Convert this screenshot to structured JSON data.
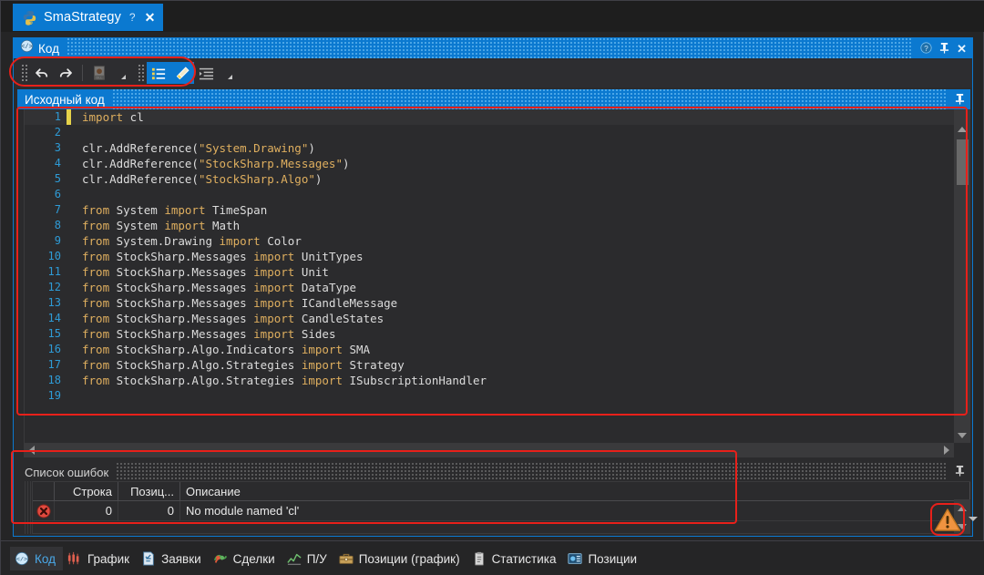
{
  "window": {
    "document_tab": {
      "title": "SmaStrategy",
      "icon": "python-icon",
      "help_label": "?",
      "close_label": "✕"
    }
  },
  "code_panel": {
    "caption": "Код",
    "icon": "code-icon",
    "help_label": "?",
    "pin_label": "⚐",
    "close_label": "✕",
    "toolbar": {
      "buttons": [
        {
          "name": "undo-button",
          "glyph": "↶",
          "state": "enabled"
        },
        {
          "name": "redo-button",
          "glyph": "↷",
          "state": "enabled"
        },
        {
          "name": "references-button",
          "glyph": "dll-file-icon",
          "state": "disabled"
        },
        {
          "name": "references-dropdown",
          "glyph": "caret",
          "state": "enabled"
        },
        {
          "name": "outline-toggle",
          "glyph": "list-icon",
          "state": "active"
        },
        {
          "name": "highlight-toggle",
          "glyph": "marker-pen-icon",
          "state": "active"
        },
        {
          "name": "indent-button",
          "glyph": "indent-icon",
          "state": "enabled"
        },
        {
          "name": "indent-dropdown",
          "glyph": "caret",
          "state": "enabled"
        }
      ]
    }
  },
  "source_panel": {
    "caption": "Исходный код",
    "pin_label": "⚐",
    "scroll": {
      "vertical": "near-top",
      "horizontal": "left"
    }
  },
  "editor": {
    "language": "python",
    "current_line": 1,
    "lines": [
      {
        "n": "1",
        "text": "import cl",
        "modified": true,
        "current": true
      },
      {
        "n": "2",
        "text": "",
        "modified": false,
        "current": false
      },
      {
        "n": "3",
        "text": "clr.AddReference(\"System.Drawing\")",
        "modified": false,
        "current": false
      },
      {
        "n": "4",
        "text": "clr.AddReference(\"StockSharp.Messages\")",
        "modified": false,
        "current": false
      },
      {
        "n": "5",
        "text": "clr.AddReference(\"StockSharp.Algo\")",
        "modified": false,
        "current": false
      },
      {
        "n": "6",
        "text": "",
        "modified": false,
        "current": false
      },
      {
        "n": "7",
        "text": "from System import TimeSpan",
        "modified": false,
        "current": false
      },
      {
        "n": "8",
        "text": "from System import Math",
        "modified": false,
        "current": false
      },
      {
        "n": "9",
        "text": "from System.Drawing import Color",
        "modified": false,
        "current": false
      },
      {
        "n": "10",
        "text": "from StockSharp.Messages import UnitTypes",
        "modified": false,
        "current": false
      },
      {
        "n": "11",
        "text": "from StockSharp.Messages import Unit",
        "modified": false,
        "current": false
      },
      {
        "n": "12",
        "text": "from StockSharp.Messages import DataType",
        "modified": false,
        "current": false
      },
      {
        "n": "13",
        "text": "from StockSharp.Messages import ICandleMessage",
        "modified": false,
        "current": false
      },
      {
        "n": "14",
        "text": "from StockSharp.Messages import CandleStates",
        "modified": false,
        "current": false
      },
      {
        "n": "15",
        "text": "from StockSharp.Messages import Sides",
        "modified": false,
        "current": false
      },
      {
        "n": "16",
        "text": "from StockSharp.Algo.Indicators import SMA",
        "modified": false,
        "current": false
      },
      {
        "n": "17",
        "text": "from StockSharp.Algo.Strategies import Strategy",
        "modified": false,
        "current": false
      },
      {
        "n": "18",
        "text": "from StockSharp.Algo.Strategies import ISubscriptionHandler",
        "modified": false,
        "current": false
      },
      {
        "n": "19",
        "text": "",
        "modified": false,
        "current": false
      }
    ]
  },
  "error_list": {
    "caption": "Список ошибок",
    "pin_label": "⚐",
    "columns": [
      "",
      "Строка",
      "Позиц...",
      "Описание"
    ],
    "rows": [
      {
        "icon": "error-icon",
        "line": "0",
        "pos": "0",
        "description": "No module named 'cl'"
      }
    ],
    "status_icon": "warning-icon"
  },
  "bottom_tabs": [
    {
      "label": "Код",
      "icon": "code-icon",
      "selected": true
    },
    {
      "label": "График",
      "icon": "candle-chart-icon",
      "selected": false
    },
    {
      "label": "Заявки",
      "icon": "orders-icon",
      "selected": false
    },
    {
      "label": "Сделки",
      "icon": "trades-icon",
      "selected": false
    },
    {
      "label": "П/У",
      "icon": "pnl-line-icon",
      "selected": false
    },
    {
      "label": "Позиции (график)",
      "icon": "briefcase-icon",
      "selected": false
    },
    {
      "label": "Статистика",
      "icon": "clipboard-icon",
      "selected": false
    },
    {
      "label": "Позиции",
      "icon": "positions-icon",
      "selected": false
    }
  ],
  "colors": {
    "accent": "#0b79d0",
    "panel_bg": "#2b2b2d",
    "editor_bg": "#2b2b2d",
    "keyword": "#dfaf5f",
    "line_number": "#2e9bd6",
    "annotation_ring": "#e8201a",
    "warning": "#e8922a",
    "error": "#e04a3f"
  }
}
